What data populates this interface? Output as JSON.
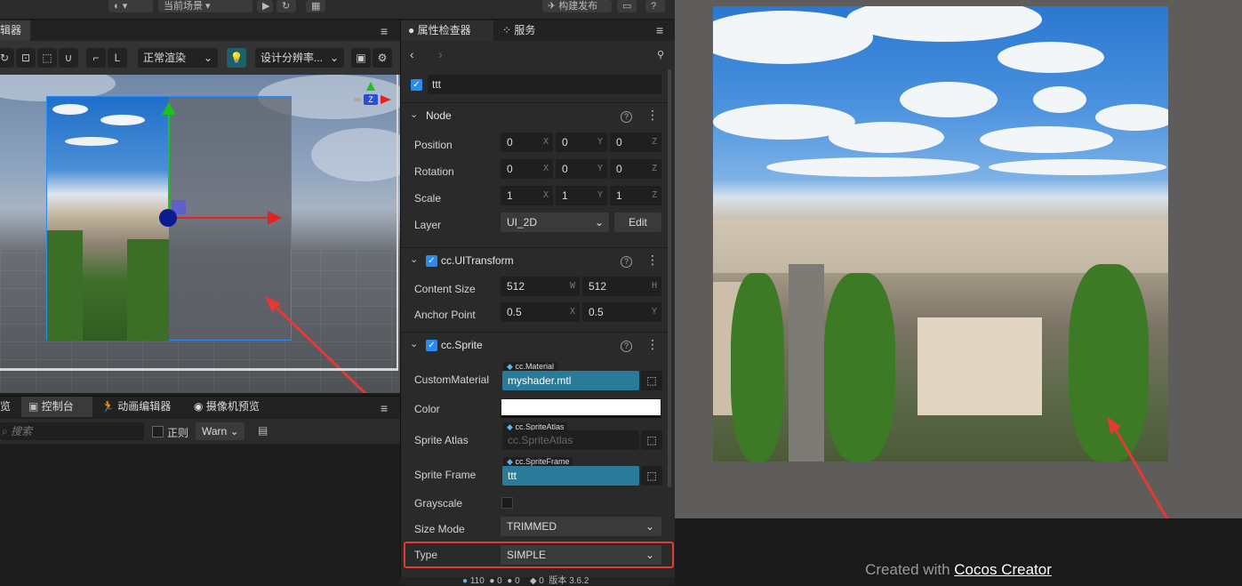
{
  "toolbar": {
    "scene_select": "当前场景",
    "build_label": "构建发布"
  },
  "scene_panel": {
    "tab_label": "辑器",
    "render_mode": "正常渲染",
    "resolution": "设计分辨率..."
  },
  "console": {
    "tabs": [
      "览",
      "控制台",
      "动画编辑器",
      "摄像机预览"
    ],
    "search_placeholder": "搜索",
    "regex_label": "正则",
    "level": "Warn"
  },
  "inspector": {
    "tabs": [
      "属性检查器",
      "服务"
    ],
    "node_name": "ttt",
    "node_section": "Node",
    "position": {
      "label": "Position",
      "x": "0",
      "y": "0",
      "z": "0"
    },
    "rotation": {
      "label": "Rotation",
      "x": "0",
      "y": "0",
      "z": "0"
    },
    "scale": {
      "label": "Scale",
      "x": "1",
      "y": "1",
      "z": "1"
    },
    "layer": {
      "label": "Layer",
      "value": "UI_2D",
      "edit": "Edit"
    },
    "uitransform_section": "cc.UITransform",
    "content_size": {
      "label": "Content Size",
      "w": "512",
      "h": "512"
    },
    "anchor_point": {
      "label": "Anchor Point",
      "x": "0.5",
      "y": "0.5"
    },
    "sprite_section": "cc.Sprite",
    "custom_material": {
      "label": "CustomMaterial",
      "tag": "cc.Material",
      "value": "myshader.mtl"
    },
    "color": {
      "label": "Color",
      "value": "#ffffff"
    },
    "sprite_atlas": {
      "label": "Sprite Atlas",
      "tag": "cc.SpriteAtlas",
      "value": "cc.SpriteAtlas"
    },
    "sprite_frame": {
      "label": "Sprite Frame",
      "tag": "cc.SpriteFrame",
      "value": "ttt"
    },
    "grayscale": {
      "label": "Grayscale"
    },
    "size_mode": {
      "label": "Size Mode",
      "value": "TRIMMED"
    },
    "type": {
      "label": "Type",
      "value": "SIMPLE"
    }
  },
  "statusbar": {
    "count1": "110",
    "count2": "0",
    "count3": "0",
    "count4": "0",
    "version": "版本 3.6.2"
  },
  "preview": {
    "created_with": "Created with",
    "link": "Cocos Creator"
  },
  "colors": {
    "accent": "#2a8bf0",
    "asset_bg": "#2a7a9a",
    "highlight": "#e53935"
  }
}
